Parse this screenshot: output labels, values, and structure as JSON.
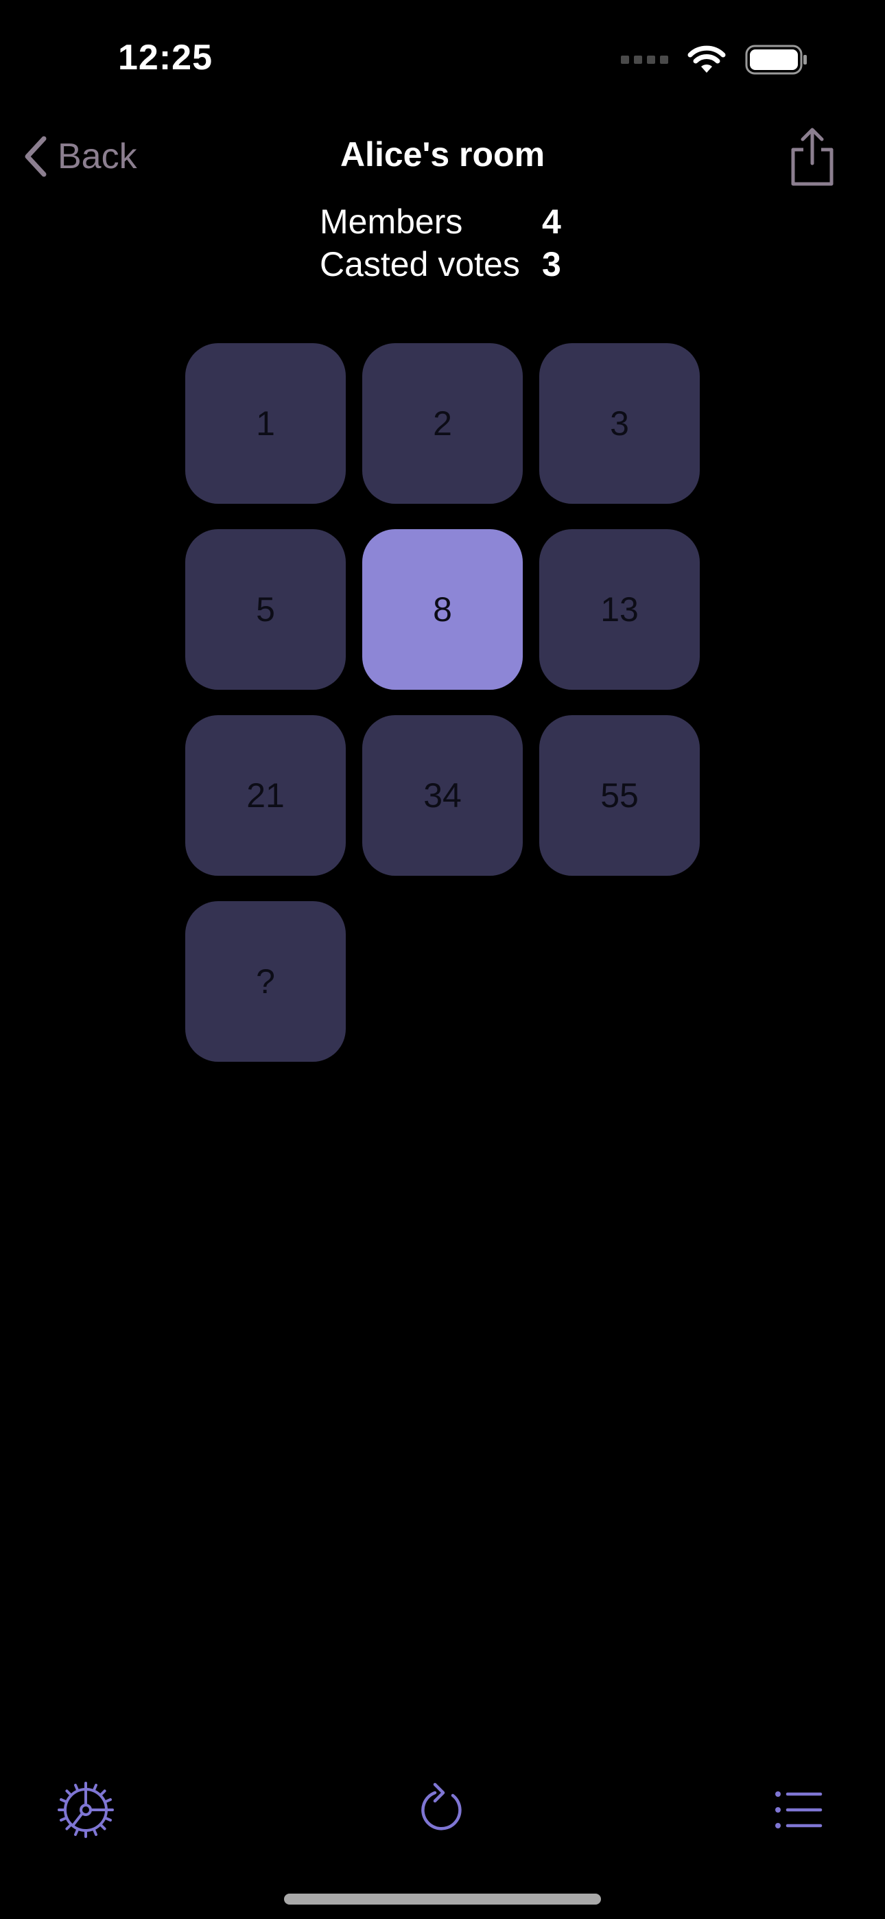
{
  "status_bar": {
    "time": "12:25",
    "icons": [
      "cellular-signal-icon",
      "wifi-icon",
      "battery-icon"
    ]
  },
  "nav": {
    "back_label": "Back",
    "title": "Alice's room",
    "share_icon": "share-icon"
  },
  "stats": {
    "members_label": "Members",
    "members_value": "4",
    "votes_label": "Casted votes",
    "votes_value": "3"
  },
  "cards": [
    "1",
    "2",
    "3",
    "5",
    "8",
    "13",
    "21",
    "34",
    "55",
    "?"
  ],
  "selected_card": "8",
  "toolbar": {
    "left_icon": "settings-icon",
    "center_icon": "refresh-icon",
    "right_icon": "list-icon"
  },
  "colors": {
    "background": "#000000",
    "card": "#353352",
    "card_selected": "#8d86d6",
    "accent": "#7f76d4",
    "back_text": "#8c7f90"
  }
}
